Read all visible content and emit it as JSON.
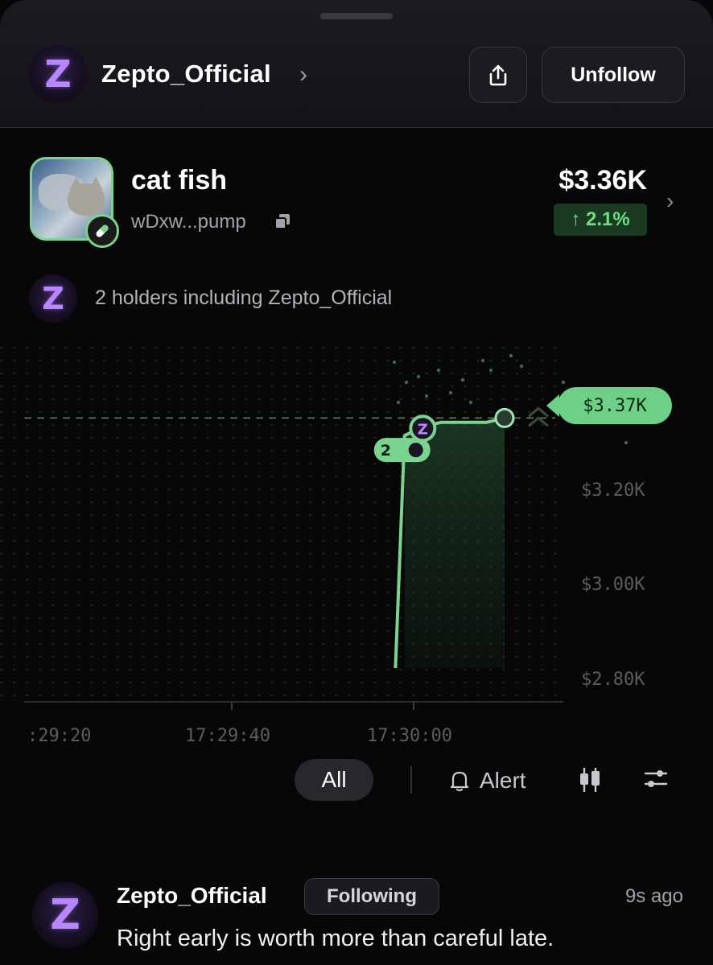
{
  "header": {
    "profile_name": "Zepto_Official",
    "unfollow_label": "Unfollow",
    "logo_letter": "Z"
  },
  "token": {
    "name": "cat fish",
    "address": "wDxw...pump",
    "price": "$3.36K",
    "change": "↑ 2.1%"
  },
  "holders": {
    "text": "2 holders including Zepto_Official"
  },
  "chart_data": {
    "type": "line",
    "series": [
      {
        "values": [
          {
            "x": "17:29:58",
            "y": 2.8
          },
          {
            "x": "17:29:59",
            "y": 3.33
          },
          {
            "x": "17:30:01",
            "y": 3.35
          },
          {
            "x": "17:30:03",
            "y": 3.36
          },
          {
            "x": "17:30:08",
            "y": 3.36
          },
          {
            "x": "17:30:10",
            "y": 3.37
          }
        ]
      }
    ],
    "y_unit": "K USD",
    "yticks": [
      "$3.20K",
      "$3.00K",
      "$2.80K"
    ],
    "xticks": [
      ":29:20",
      "17:29:40",
      "17:30:00"
    ],
    "ylim": [
      2.75,
      3.45
    ],
    "current_label": "$3.37K",
    "markers": [
      {
        "label": "2",
        "x": "17:29:59"
      },
      {
        "label": "Z",
        "x": "17:30:01"
      }
    ],
    "line_color": "#7ad48f",
    "grid": "dotted"
  },
  "controls": {
    "all_label": "All",
    "alert_label": "Alert"
  },
  "post": {
    "author": "Zepto_Official",
    "badge": "Following",
    "time": "9s ago",
    "text": "Right early is worth more than careful late."
  },
  "colors": {
    "accent_green": "#7ad48f",
    "logo_purple": "#b887ff",
    "background": "#070707"
  }
}
